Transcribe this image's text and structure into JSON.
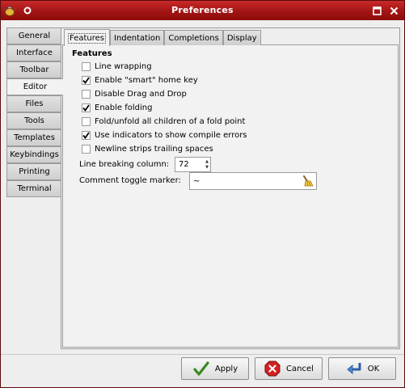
{
  "window": {
    "title": "Preferences",
    "title_bg": "#a31414"
  },
  "side_tabs": [
    {
      "label": "General"
    },
    {
      "label": "Interface"
    },
    {
      "label": "Toolbar"
    },
    {
      "label": "Editor",
      "selected": true
    },
    {
      "label": "Files"
    },
    {
      "label": "Tools"
    },
    {
      "label": "Templates"
    },
    {
      "label": "Keybindings"
    },
    {
      "label": "Printing"
    },
    {
      "label": "Terminal"
    }
  ],
  "inner_tabs": [
    {
      "label": "Features",
      "selected": true
    },
    {
      "label": "Indentation"
    },
    {
      "label": "Completions"
    },
    {
      "label": "Display"
    }
  ],
  "features": {
    "heading": "Features",
    "options": [
      {
        "label": "Line wrapping",
        "checked": false
      },
      {
        "label": "Enable \"smart\" home key",
        "checked": true
      },
      {
        "label": "Disable Drag and Drop",
        "checked": false
      },
      {
        "label": "Enable folding",
        "checked": true
      },
      {
        "label": "Fold/unfold all children of a fold point",
        "checked": false
      },
      {
        "label": "Use indicators to show compile errors",
        "checked": true
      },
      {
        "label": "Newline strips trailing spaces",
        "checked": false
      }
    ],
    "line_breaking_label": "Line breaking column:",
    "line_breaking_value": "72",
    "comment_toggle_label": "Comment toggle marker:",
    "comment_toggle_value": "~"
  },
  "buttons": {
    "apply": "Apply",
    "cancel": "Cancel",
    "ok": "OK"
  },
  "icons": {
    "app": "geany-teapot-icon",
    "pin": "pin-icon",
    "maximize": "maximize-icon",
    "close": "close-icon",
    "clear": "broom-clear-icon",
    "apply": "checkmark-icon",
    "cancel": "cancel-icon",
    "ok": "ok-arrow-icon"
  }
}
